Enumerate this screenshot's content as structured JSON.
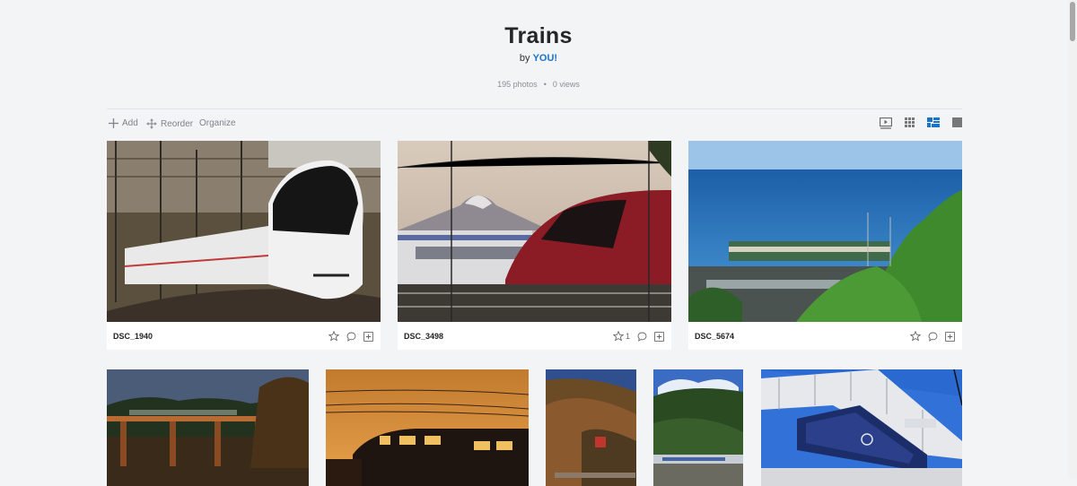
{
  "album": {
    "title": "Trains",
    "by_prefix": "by",
    "owner": "YOU!",
    "photo_count": "195 photos",
    "separator": "•",
    "views": "0 views"
  },
  "toolbar": {
    "add_label": "Add",
    "reorder_label": "Reorder",
    "organize_label": "Organize",
    "views": [
      "slideshow-view-icon",
      "grid-view-icon",
      "mosaic-view-icon",
      "single-view-icon"
    ],
    "active_view": "mosaic-view-icon"
  },
  "photos": [
    {
      "name": "DSC_1940",
      "likes": "",
      "icons": [
        "star-icon",
        "comment-icon",
        "add-to-icon"
      ]
    },
    {
      "name": "DSC_3498",
      "likes": "1",
      "icons": [
        "star-icon",
        "comment-icon",
        "add-to-icon"
      ]
    },
    {
      "name": "DSC_5674",
      "likes": "",
      "icons": [
        "star-icon",
        "comment-icon",
        "add-to-icon"
      ]
    }
  ],
  "colors": {
    "accent": "#1a73c8",
    "background": "#f3f4f6"
  }
}
